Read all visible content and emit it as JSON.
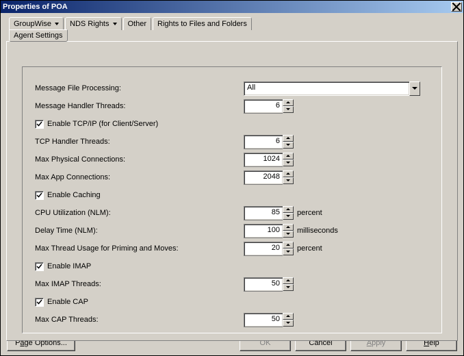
{
  "title": "Properties of POA",
  "tabs": {
    "groupwise": "GroupWise",
    "nds": "NDS Rights",
    "other": "Other",
    "rights": "Rights to Files and Folders"
  },
  "subtab": "Agent Settings",
  "fields": {
    "msg_file_proc": {
      "label": "Message File Processing:",
      "value": "All"
    },
    "msg_handler": {
      "label": "Message Handler Threads:",
      "value": "6"
    },
    "enable_tcpip": {
      "label": "Enable TCP/IP (for Client/Server)"
    },
    "tcp_handler": {
      "label": "TCP Handler Threads:",
      "value": "6"
    },
    "max_phys": {
      "label": "Max Physical Connections:",
      "value": "1024"
    },
    "max_app": {
      "label": "Max App Connections:",
      "value": "2048"
    },
    "enable_caching": {
      "label": "Enable Caching"
    },
    "cpu_util": {
      "label": "CPU Utilization (NLM):",
      "value": "85",
      "unit": "percent"
    },
    "delay_time": {
      "label": "Delay Time (NLM):",
      "value": "100",
      "unit": "milliseconds"
    },
    "max_thread": {
      "label": "Max Thread Usage for Priming and Moves:",
      "value": "20",
      "unit": "percent"
    },
    "enable_imap": {
      "label": "Enable IMAP"
    },
    "max_imap": {
      "label": "Max IMAP Threads:",
      "value": "50"
    },
    "enable_cap": {
      "label": "Enable CAP"
    },
    "max_cap": {
      "label": "Max CAP Threads:",
      "value": "50"
    }
  },
  "buttons": {
    "page_options_pre": "P",
    "page_options_ul": "a",
    "page_options_post": "ge Options...",
    "ok": "OK",
    "cancel": "Cancel",
    "apply_ul": "A",
    "apply_post": "pply",
    "help_ul": "H",
    "help_post": "elp"
  }
}
